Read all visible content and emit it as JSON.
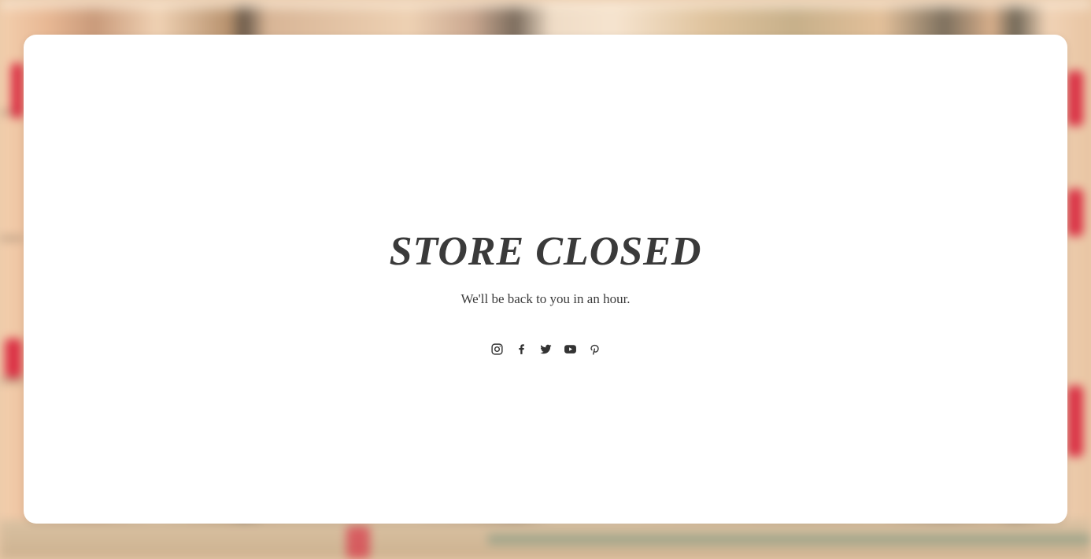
{
  "page": {
    "title": "STORE CLOSED",
    "message": "We'll be back to you in an hour."
  },
  "social": [
    {
      "name": "instagram",
      "icon": "instagram-icon"
    },
    {
      "name": "facebook",
      "icon": "facebook-icon"
    },
    {
      "name": "twitter",
      "icon": "twitter-icon"
    },
    {
      "name": "youtube",
      "icon": "youtube-icon"
    },
    {
      "name": "pinterest",
      "icon": "pinterest-icon"
    }
  ],
  "colors": {
    "card_background": "#ffffff",
    "text": "#3a3a3a",
    "icon": "#333333",
    "accent_red": "#d8203a"
  }
}
